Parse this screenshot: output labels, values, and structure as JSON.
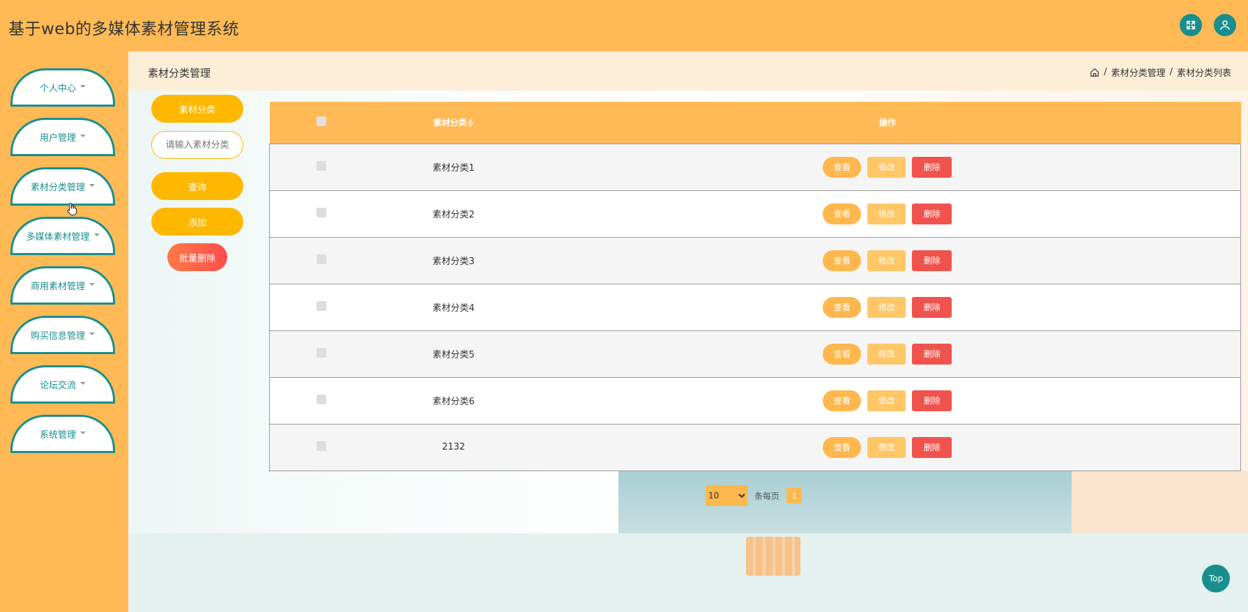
{
  "app": {
    "title": "基于web的多媒体素材管理系统"
  },
  "header": {
    "icons": [
      "fullscreen-icon",
      "user-icon"
    ]
  },
  "sidebar": {
    "items": [
      {
        "label": "个人中心"
      },
      {
        "label": "用户管理"
      },
      {
        "label": "素材分类管理"
      },
      {
        "label": "多媒体素材管理"
      },
      {
        "label": "商用素材管理"
      },
      {
        "label": "购买信息管理"
      },
      {
        "label": "论坛交流"
      },
      {
        "label": "系统管理"
      }
    ]
  },
  "breadcrumb": {
    "page_title": "素材分类管理",
    "sep": "/",
    "path": [
      "素材分类管理",
      "素材分类列表"
    ]
  },
  "filter": {
    "label": "素材分类",
    "placeholder": "请输入素材分类",
    "query_label": "查询",
    "add_label": "添加",
    "batch_delete_label": "批量删除"
  },
  "table": {
    "headers": {
      "name": "素材分类",
      "sort_mark": "≑",
      "ops": "操作"
    },
    "rows": [
      {
        "name": "素材分类1"
      },
      {
        "name": "素材分类2"
      },
      {
        "name": "素材分类3"
      },
      {
        "name": "素材分类4"
      },
      {
        "name": "素材分类5"
      },
      {
        "name": "素材分类6"
      },
      {
        "name": "2132"
      }
    ],
    "actions": {
      "view": "查看",
      "edit": "修改",
      "delete": "删除"
    }
  },
  "pager": {
    "page_size": "10",
    "per_page_label": "条每页",
    "current_page": "1"
  },
  "top_button": {
    "label": "Top"
  },
  "colors": {
    "accent": "#ffba55",
    "teal": "#1a8e8e",
    "danger": "#f0534d"
  }
}
